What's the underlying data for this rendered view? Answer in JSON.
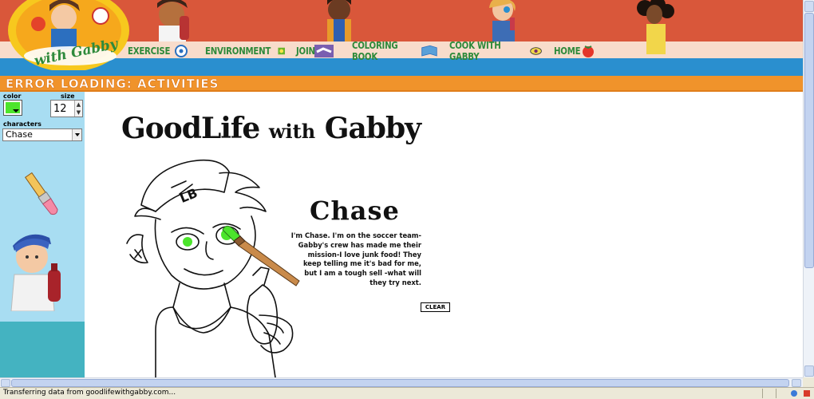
{
  "header": {
    "logo_text": "with Gabby",
    "nav": [
      {
        "label": "EXERCISE",
        "icon": "soccer-ball-icon"
      },
      {
        "label": "ENVIRONMENT",
        "icon": "sun-icon"
      },
      {
        "label": "JOIN",
        "icon": "handshake-icon"
      },
      {
        "label": "COLORING BOOK",
        "icon": "book-icon"
      },
      {
        "label": "COOK WITH GABBY",
        "icon": "eye-icon"
      },
      {
        "label": "HOME",
        "icon": "tomato-icon"
      }
    ]
  },
  "title_bar": {
    "text": "ERROR LOADING: ACTIVITIES"
  },
  "sidebar": {
    "color_label": "color",
    "size_label": "size",
    "size_value": "12",
    "characters_label": "characters",
    "selected_character": "Chase",
    "current_color": "#4ce52c"
  },
  "canvas": {
    "title_main": "GoodLife",
    "title_with": "with",
    "title_gabby": "Gabby",
    "character_name": "Chase",
    "character_description": "I'm Chase. I'm on the soccer team- Gabby's crew has made me their mission-I love junk food! They keep telling me it's bad for me, but I am a tough sell -what will they try next.",
    "clear_label": "CLEAR"
  },
  "status": {
    "text": "Transferring data from goodlifewithgabby.com..."
  },
  "colors": {
    "header": "#d9573a",
    "nav_green": "#2f8a3b",
    "bar_orange": "#f0932b",
    "sidebar": "#a8ddf2",
    "paint_green": "#4ce52c"
  }
}
